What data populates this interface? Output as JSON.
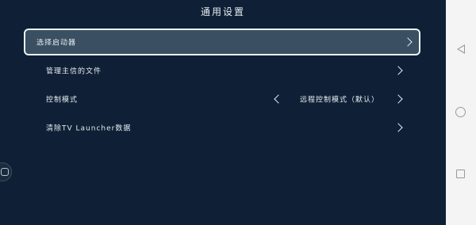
{
  "header": {
    "title": "通用设置"
  },
  "settings": {
    "items": [
      {
        "label": "选择启动器"
      },
      {
        "label": "管理主信的文件"
      },
      {
        "label": "控制模式",
        "value": "远程控制模式（默认）"
      },
      {
        "label": "清除TV Launcher数据"
      }
    ]
  },
  "icons": {
    "chevron_right": "chevron-right-icon",
    "chevron_left": "chevron-left-icon",
    "side_button": "gamepad-icon",
    "nav_back": "nav-back-icon",
    "nav_home": "nav-home-icon",
    "nav_recent": "nav-recent-icon"
  },
  "colors": {
    "background": "#0f2036",
    "selected_row": "#3a4f62",
    "selected_border": "#eef2f5",
    "text": "#e6ecf2",
    "navbar": "#f4f4f4"
  }
}
